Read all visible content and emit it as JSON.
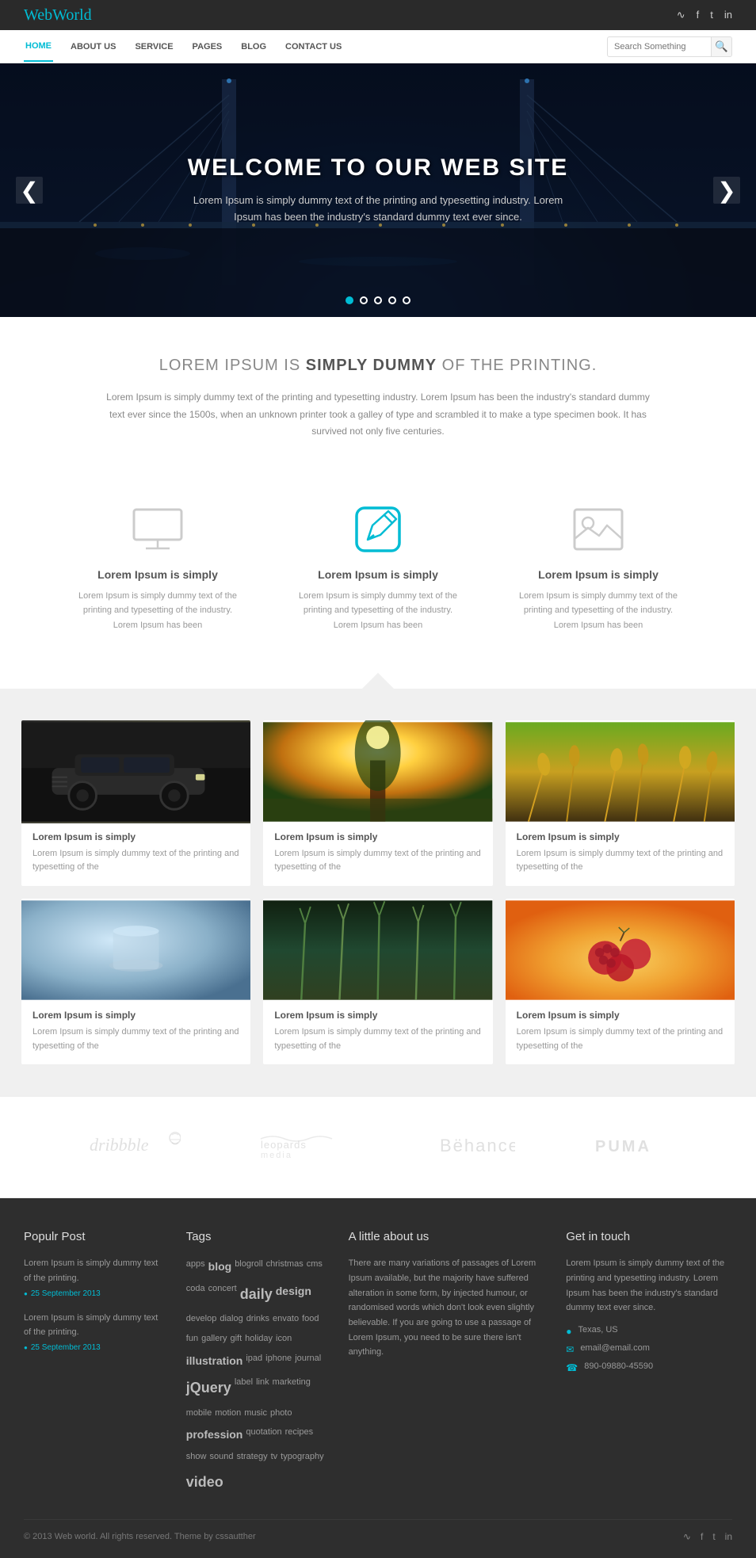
{
  "site": {
    "logo_web": "Web",
    "logo_world": "World"
  },
  "topbar": {
    "social": [
      "rss",
      "f",
      "t",
      "in"
    ]
  },
  "nav": {
    "links": [
      "HOME",
      "ABOUT US",
      "SERVICE",
      "PAGES",
      "BLOG",
      "CONTACT US"
    ],
    "active": "HOME",
    "search_placeholder": "Search Something"
  },
  "hero": {
    "title": "WELCOME TO OUR WEB SITE",
    "subtitle": "Lorem Ipsum is simply dummy text of the printing and typesetting industry. Lorem Ipsum has been the industry's standard dummy text ever since.",
    "prev_label": "❮",
    "next_label": "❯",
    "dots": [
      true,
      false,
      false,
      false,
      false
    ]
  },
  "intro": {
    "heading_plain": "LOREM IPSUM IS ",
    "heading_bold": "SIMPLY DUMMY",
    "heading_end": " OF THE PRINTING.",
    "body": "Lorem Ipsum is simply dummy text of the printing and typesetting industry. Lorem Ipsum has been the industry's standard dummy text ever since the 1500s, when an unknown printer took a galley of type and scrambled it to make a type specimen book.\nIt has survived not only five centuries."
  },
  "features": [
    {
      "type": "monitor",
      "title_bold": "Lorem Ipsum",
      "title_plain": " is simply",
      "body": "Lorem Ipsum is simply dummy text of the printing and typesetting of the industry. Lorem Ipsum has been"
    },
    {
      "type": "edit",
      "title_bold": "Lorem Ipsum",
      "title_plain": " is simply",
      "body": "Lorem Ipsum is simply dummy text of the printing and typesetting of the industry. Lorem Ipsum has been"
    },
    {
      "type": "image",
      "title_bold": "Lorem Ipsum",
      "title_plain": " is simply",
      "body": "Lorem Ipsum is simply dummy text of the printing and typesetting of the industry. Lorem Ipsum has been"
    }
  ],
  "portfolio": {
    "items": [
      {
        "img_class": "img-car",
        "title_bold": "Lorem Ipsum is simply",
        "body": "Lorem Ipsum is simply dummy text of the printing and typesetting of the"
      },
      {
        "img_class": "img-sunlight",
        "title_bold": "Lorem Ipsum is simply",
        "body": "Lorem Ipsum is simply dummy text of the printing and typesetting of the"
      },
      {
        "img_class": "img-wheat",
        "title_bold": "Lorem Ipsum is simply",
        "body": "Lorem Ipsum is simply dummy text of the printing and typesetting of the"
      },
      {
        "img_class": "img-blur",
        "title_bold": "Lorem Ipsum is simply",
        "body": "Lorem Ipsum is simply dummy text of the printing and typesetting of the"
      },
      {
        "img_class": "img-green",
        "title_bold": "Lorem Ipsum is simply",
        "body": "Lorem Ipsum is simply dummy text of the printing and typesetting of the"
      },
      {
        "img_class": "img-berries",
        "title_bold": "Lorem Ipsum is simply",
        "body": "Lorem Ipsum is simply dummy text of the printing and typesetting of the"
      }
    ]
  },
  "brands": [
    {
      "name": "dribbble",
      "label": "dribbble ✿"
    },
    {
      "name": "leopards",
      "label": "leopards media"
    },
    {
      "name": "behance",
      "label": "Bëhance"
    },
    {
      "name": "puma",
      "label": "PUMA >"
    }
  ],
  "footer": {
    "popular_post": {
      "heading": "Populr Post",
      "posts": [
        {
          "text": "Lorem Ipsum is simply dummy text of the printing.",
          "date": "25 September 2013"
        },
        {
          "text": "Lorem Ipsum is simply dummy text of the printing.",
          "date": "25 September 2013"
        }
      ]
    },
    "tags": {
      "heading": "Tags",
      "items": [
        {
          "label": "apps",
          "size": "small"
        },
        {
          "label": "blog",
          "size": "large"
        },
        {
          "label": "blogroll",
          "size": "small"
        },
        {
          "label": "christmas",
          "size": "small"
        },
        {
          "label": "cms",
          "size": "small"
        },
        {
          "label": "coda",
          "size": "small"
        },
        {
          "label": "concert",
          "size": "small"
        },
        {
          "label": "daily",
          "size": "xlarge"
        },
        {
          "label": "design",
          "size": "large"
        },
        {
          "label": "develop",
          "size": "small"
        },
        {
          "label": "dialog",
          "size": "small"
        },
        {
          "label": "drinks",
          "size": "small"
        },
        {
          "label": "envato",
          "size": "small"
        },
        {
          "label": "food",
          "size": "small"
        },
        {
          "label": "fun",
          "size": "small"
        },
        {
          "label": "gallery",
          "size": "small"
        },
        {
          "label": "gift",
          "size": "small"
        },
        {
          "label": "holiday",
          "size": "small"
        },
        {
          "label": "icon",
          "size": "small"
        },
        {
          "label": "illustration",
          "size": "large"
        },
        {
          "label": "ipad",
          "size": "small"
        },
        {
          "label": "iphone",
          "size": "small"
        },
        {
          "label": "journal",
          "size": "small"
        },
        {
          "label": "jQuery",
          "size": "xlarge"
        },
        {
          "label": "label",
          "size": "small"
        },
        {
          "label": "link",
          "size": "small"
        },
        {
          "label": "marketing",
          "size": "small"
        },
        {
          "label": "mobile",
          "size": "small"
        },
        {
          "label": "motion",
          "size": "small"
        },
        {
          "label": "music",
          "size": "small"
        },
        {
          "label": "photo",
          "size": "small"
        },
        {
          "label": "profession",
          "size": "large"
        },
        {
          "label": "quotation",
          "size": "small"
        },
        {
          "label": "recipes",
          "size": "small"
        },
        {
          "label": "show",
          "size": "small"
        },
        {
          "label": "sound",
          "size": "small"
        },
        {
          "label": "strategy",
          "size": "small"
        },
        {
          "label": "tv",
          "size": "small"
        },
        {
          "label": "typography",
          "size": "small"
        },
        {
          "label": "video",
          "size": "xlarge"
        }
      ]
    },
    "about": {
      "heading": "A little about us",
      "text": "There are many variations of passages of Lorem Ipsum available, but the majority have suffered alteration in some form, by injected humour, or randomised words which don't look even slightly believable.\n\nIf you are going to use a passage of Lorem Ipsum, you need to be sure there isn't anything."
    },
    "contact": {
      "heading": "Get in touch",
      "intro": "Lorem Ipsum is simply dummy text of the printing and typesetting industry. Lorem Ipsum has been the industry's standard dummy text ever since.",
      "address": "Texas, US",
      "email": "email@email.com",
      "phone": "890-09880-45590"
    },
    "bottom": {
      "copyright": "© 2013 Web world. All rights reserved. Theme by cssautther"
    }
  }
}
